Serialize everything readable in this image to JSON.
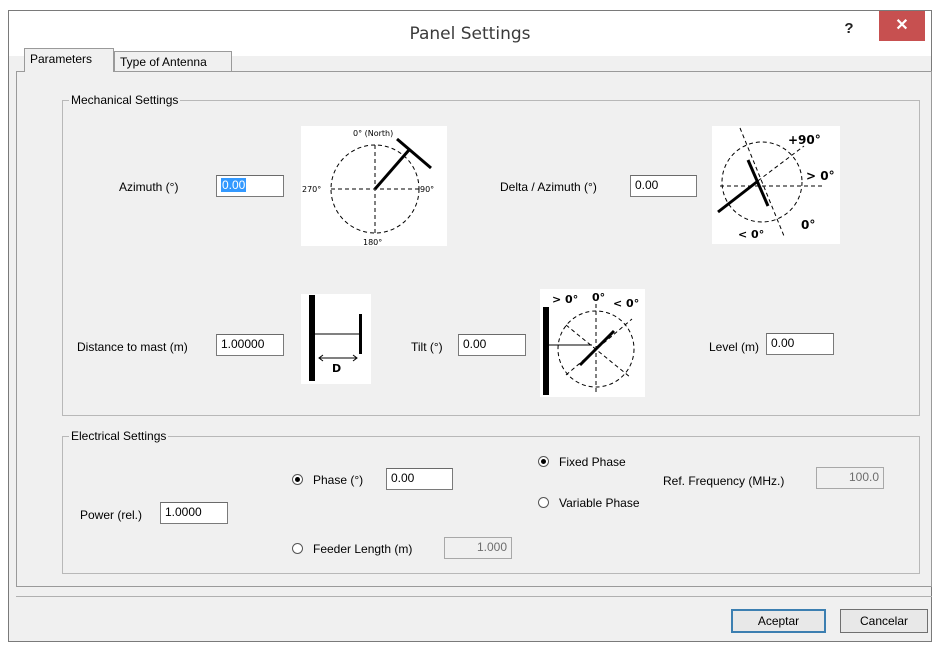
{
  "window": {
    "title": "Panel Settings",
    "help_label": "?",
    "close_label": "✕"
  },
  "tabs": [
    {
      "label": "Parameters"
    },
    {
      "label": "Type of Antenna"
    }
  ],
  "mechanical": {
    "legend": "Mechanical Settings",
    "azimuth_label": "Azimuth (°)",
    "azimuth_value": "0.00",
    "delta_azimuth_label": "Delta / Azimuth (°)",
    "delta_azimuth_value": "0.00",
    "distance_label": "Distance to mast (m)",
    "distance_value": "1.00000",
    "tilt_label": "Tilt (°)",
    "tilt_value": "0.00",
    "level_label": "Level (m)",
    "level_value": "0.00",
    "diagram_azimuth": {
      "north": "0° (North)",
      "east": "90°",
      "south": "180°",
      "west": "270°"
    },
    "diagram_delta": {
      "plus90": "+90°",
      "gt0": "> 0°",
      "zero": "0°",
      "lt0": "< 0°"
    },
    "diagram_distance": {
      "d": "D"
    },
    "diagram_tilt": {
      "gt0": "> 0°",
      "zero": "0°",
      "lt0": "< 0°"
    }
  },
  "electrical": {
    "legend": "Electrical Settings",
    "power_label": "Power (rel.)",
    "power_value": "1.0000",
    "phase_label": "Phase (°)",
    "phase_value": "0.00",
    "feeder_label": "Feeder Length (m)",
    "feeder_value": "1.000",
    "fixed_phase_label": "Fixed Phase",
    "variable_phase_label": "Variable Phase",
    "ref_freq_label": "Ref. Frequency (MHz.)",
    "ref_freq_value": "100.0"
  },
  "buttons": {
    "ok": "Aceptar",
    "cancel": "Cancelar"
  }
}
